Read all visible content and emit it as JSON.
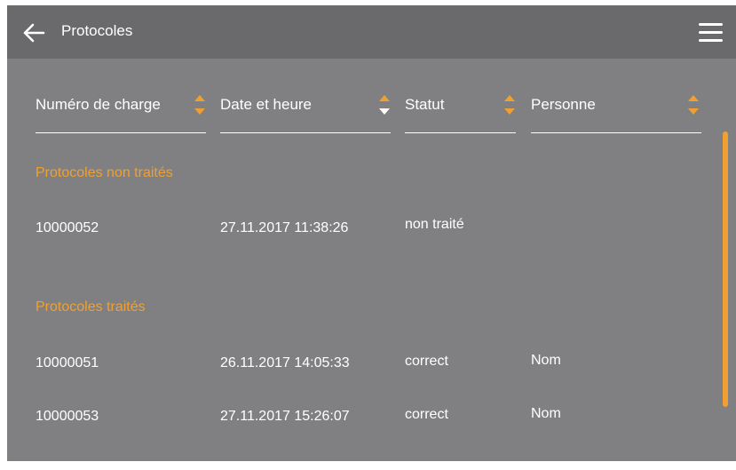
{
  "header": {
    "title": "Protocoles",
    "back_icon": "arrow-left-icon",
    "menu_icon": "hamburger-menu-icon"
  },
  "columns": [
    {
      "label": "Numéro de charge",
      "sort": "none"
    },
    {
      "label": "Date et heure",
      "sort": "descending"
    },
    {
      "label": "Statut",
      "sort": "none"
    },
    {
      "label": "Personne",
      "sort": "none"
    }
  ],
  "sections": {
    "untreated": {
      "title": "Protocoles non traités",
      "rows": [
        {
          "charge": "10000052",
          "datetime": "27.11.2017 11:38:26",
          "status": "non traité",
          "person": ""
        }
      ]
    },
    "treated": {
      "title": "Protocoles traités",
      "rows": [
        {
          "charge": "10000051",
          "datetime": "26.11.2017 14:05:33",
          "status": "correct",
          "person": "Nom"
        },
        {
          "charge": "10000053",
          "datetime": "27.11.2017 15:26:07",
          "status": "correct",
          "person": "Nom"
        }
      ]
    }
  },
  "colors": {
    "accent": "#f0a030",
    "panel": "#808083",
    "topbar": "#6a6a6d",
    "text": "#ffffff"
  }
}
